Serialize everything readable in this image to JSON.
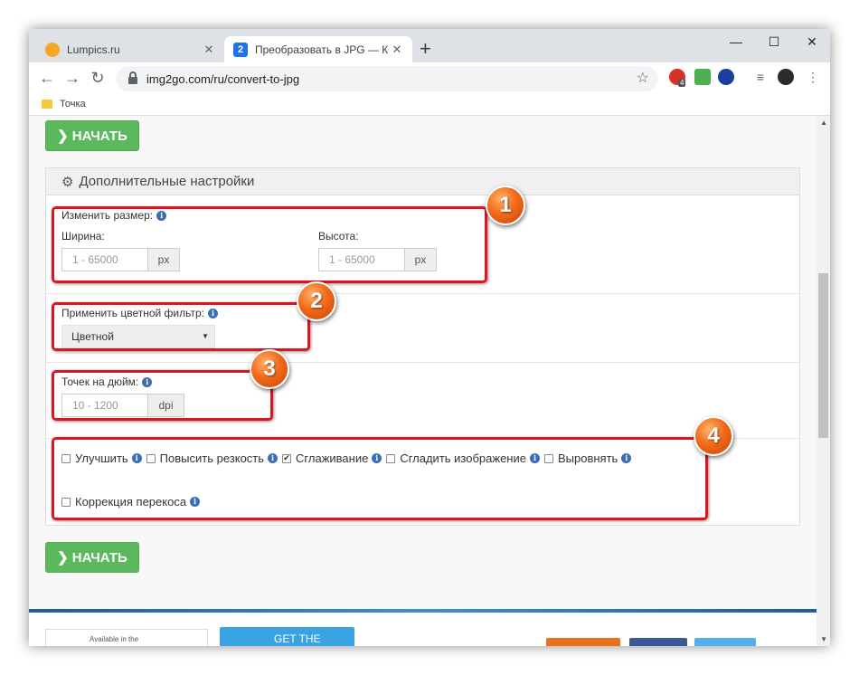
{
  "browser": {
    "tabs": [
      {
        "title": "Lumpics.ru",
        "close": "✕"
      },
      {
        "title": "Преобразовать в JPG — Конвер",
        "favicon_text": "2",
        "close": "✕"
      }
    ],
    "newtab": "+",
    "window_controls": {
      "minimize": "—",
      "maximize": "☐",
      "close": "✕"
    },
    "url": "img2go.com/ru/convert-to-jpg",
    "bookmark": "Точка",
    "extension_badge": "4"
  },
  "page": {
    "start_label": "НАЧАТЬ",
    "panel_title": "Дополнительные настройки",
    "resize": {
      "label": "Изменить размер:",
      "width_label": "Ширина:",
      "height_label": "Высота:",
      "width_placeholder": "1 - 65000",
      "height_placeholder": "1 - 65000",
      "unit": "px"
    },
    "color_filter": {
      "label": "Применить цветной фильтр:",
      "selected": "Цветной"
    },
    "dpi": {
      "label": "Точек на дюйм:",
      "placeholder": "10 - 1200",
      "unit": "dpi"
    },
    "options": [
      {
        "label": "Улучшить",
        "checked": false
      },
      {
        "label": "Повысить резкость",
        "checked": false
      },
      {
        "label": "Сглаживание",
        "checked": true
      },
      {
        "label": "Сгладить изображение",
        "checked": false
      },
      {
        "label": "Выровнять",
        "checked": false
      },
      {
        "label": "Коррекция перекоса",
        "checked": false
      }
    ],
    "info_glyph": "i"
  },
  "annotations": [
    "1",
    "2",
    "3",
    "4"
  ],
  "footer": {
    "store_text": "Available in the",
    "get_text": "GET THE"
  },
  "colors": {
    "accent_green": "#5cb85c",
    "annotation_red": "#e0141e",
    "badge_orange": "#f26a1b",
    "info_blue": "#3a6fb4"
  }
}
